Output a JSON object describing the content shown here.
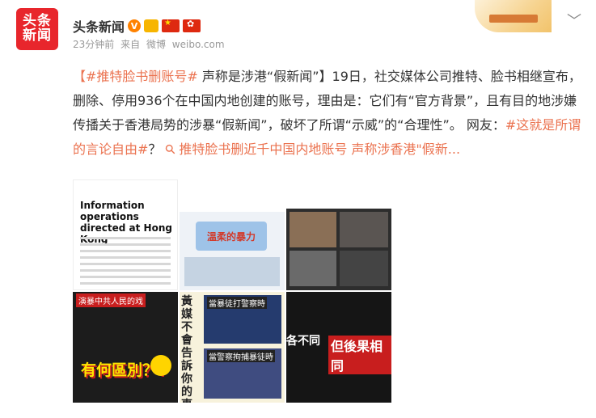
{
  "account": {
    "avatar_lines": [
      "头条",
      "新闻"
    ],
    "name": "头条新闻",
    "verified_mark": "V",
    "time": "23分钟前",
    "source_prefix": "来自",
    "source": "微博",
    "source_site": "weibo.com"
  },
  "post": {
    "hashtag_main": "【#推特脸书删账号#",
    "title": "声称是涉港“假新闻”】",
    "body": "19日，社交媒体公司推特、脸书相继宣布，删除、停用936个在中国内地创建的账号，理由是：它们有“官方背景”，且有目的地涉嫌传播关于香港局势的涉暴“假新闻”，破坏了所谓“示威”的“合理性”。",
    "netizen_label": "网友：",
    "hashtag_2": "#这就是所谓的言论自由#",
    "question_mark": "？",
    "link_icon": "link-icon",
    "link_text": "推特脸书删近千中国内地账号 声称涉香港\"假新..."
  },
  "images": {
    "img1_title": "Information operations directed at Hong Kong",
    "img2_banner": "溫柔的暴力",
    "img4_overlay": "有何區別？!",
    "img4_tag": "演暴中共人民的戏",
    "img5_side": "黃媒不會告訴你的事",
    "img5_caption1": "當暴徒打警察時",
    "img5_caption2": "當警察拘捕暴徒時",
    "img6_left": "各不同",
    "img6_right": "但後果相同"
  },
  "colors": {
    "link": "#eb7350",
    "brand_red": "#e8262c"
  }
}
